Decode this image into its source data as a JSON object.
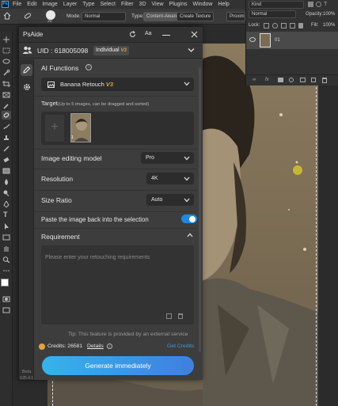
{
  "menubar": {
    "app_icon": "Ps",
    "items": [
      "File",
      "Edit",
      "Image",
      "Layer",
      "Type",
      "Select",
      "Filter",
      "3D",
      "View",
      "Plugins",
      "Window",
      "Help"
    ]
  },
  "options": {
    "brush_size": "20",
    "mode_label": "Mode:",
    "mode_value": "Normal",
    "type_label": "Type:",
    "type_options": [
      "Content-Aware",
      "Create Texture",
      "Proxim"
    ]
  },
  "layers_panel": {
    "filter_value": "Kind",
    "blend_mode": "Normal",
    "opacity_label": "Opacity:",
    "opacity_value": "100%",
    "lock_label": "Lock:",
    "fill_label": "Fill:",
    "fill_value": "100%",
    "layer_name": "01"
  },
  "plugin": {
    "title": "PsAide",
    "uid_text": "UID : 618005098",
    "account_type": "Individual",
    "account_badge": "V3",
    "ai_functions_label": "AI Functions",
    "function_value": "Banana Retouch",
    "function_version": "V3",
    "target_label": "Target",
    "target_hint": "(Up to 5 images, can be dragged and sorted)",
    "thumb_index": "1",
    "model_label": "Image editing model",
    "model_value": "Pro",
    "resolution_label": "Resolution",
    "resolution_value": "4K",
    "size_ratio_label": "Size Ratio",
    "size_ratio_value": "Auto",
    "paste_label": "Paste the image back into the selection",
    "paste_on": true,
    "requirement_label": "Requirement",
    "requirement_placeholder": "Please enter your retouching requirements",
    "tip": "Tip: This feature is provided by an external service",
    "credits_text": "Credits: 26581",
    "details_label": "Details",
    "get_credits_label": "Get Credits",
    "generate_label": "Generate immediately",
    "beta_label": "Beta",
    "version_label": "V25.4.1"
  },
  "colors": {
    "accent_orange": "#e6a23c",
    "toggle_blue": "#1e88e5",
    "generate_gradient_start": "#36b3ea",
    "generate_gradient_end": "#3f7fe0",
    "get_credits": "#3a9ad9"
  }
}
